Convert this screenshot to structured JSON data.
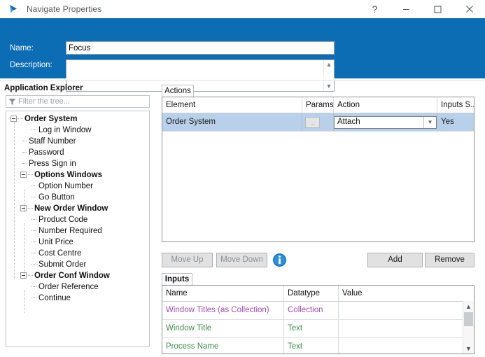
{
  "window": {
    "title": "Navigate Properties",
    "icon": "navigate-play-icon",
    "controls": {
      "help": "?",
      "minimize": "minimize-icon",
      "maximize": "maximize-icon",
      "close": "close-icon"
    },
    "accent_color": "#0c6cb4"
  },
  "header": {
    "name_label": "Name:",
    "name_value": "Focus",
    "description_label": "Description:",
    "description_value": "",
    "description_placeholder": ""
  },
  "explorer": {
    "title": "Application Explorer",
    "filter_placeholder": "Filter the tree...",
    "filter_value": "",
    "tree": [
      {
        "label": "Order System",
        "depth": 0,
        "bold": true,
        "expander": true
      },
      {
        "label": "Log in Window",
        "depth": 2,
        "bold": false,
        "expander": false
      },
      {
        "label": "Staff Number",
        "depth": 1,
        "bold": false,
        "expander": false
      },
      {
        "label": "Password",
        "depth": 1,
        "bold": false,
        "expander": false
      },
      {
        "label": "Press Sign in",
        "depth": 1,
        "bold": false,
        "expander": false
      },
      {
        "label": "Options Windows",
        "depth": 1,
        "bold": true,
        "expander": true
      },
      {
        "label": "Option Number",
        "depth": 2,
        "bold": false,
        "expander": false
      },
      {
        "label": "Go Button",
        "depth": 2,
        "bold": false,
        "expander": false
      },
      {
        "label": "New Order Window",
        "depth": 1,
        "bold": true,
        "expander": true
      },
      {
        "label": "Product Code",
        "depth": 2,
        "bold": false,
        "expander": false
      },
      {
        "label": "Number Required",
        "depth": 2,
        "bold": false,
        "expander": false
      },
      {
        "label": "Unit Price",
        "depth": 2,
        "bold": false,
        "expander": false
      },
      {
        "label": "Cost Centre",
        "depth": 2,
        "bold": false,
        "expander": false
      },
      {
        "label": "Submit Order",
        "depth": 2,
        "bold": false,
        "expander": false
      },
      {
        "label": "Order Conf Window",
        "depth": 1,
        "bold": true,
        "expander": true
      },
      {
        "label": "Order Reference",
        "depth": 2,
        "bold": false,
        "expander": false
      },
      {
        "label": "Continue",
        "depth": 2,
        "bold": false,
        "expander": false
      }
    ]
  },
  "actions": {
    "tab_label": "Actions",
    "columns": [
      "Element",
      "Params",
      "Action",
      "Inputs S..."
    ],
    "rows": [
      {
        "element": "Order System",
        "params": "...",
        "action": "Attach",
        "inputs_supplied": "Yes",
        "selected": true
      }
    ]
  },
  "toolbar": {
    "move_up": "Move Up",
    "move_down": "Move Down",
    "info_icon": "info-icon",
    "add": "Add",
    "remove": "Remove"
  },
  "inputs": {
    "tab_label": "Inputs",
    "columns": [
      "Name",
      "Datatype",
      "Value"
    ],
    "rows": [
      {
        "name": "Window Titles (as Collection)",
        "datatype": "Collection",
        "value": "",
        "color": "#a24bb0"
      },
      {
        "name": "Window Title",
        "datatype": "Text",
        "value": "",
        "color": "#3f8c4a"
      },
      {
        "name": "Process Name",
        "datatype": "Text",
        "value": "",
        "color": "#3f8c4a"
      }
    ],
    "scrollbar": {
      "up": "▲",
      "down": "▼"
    }
  }
}
